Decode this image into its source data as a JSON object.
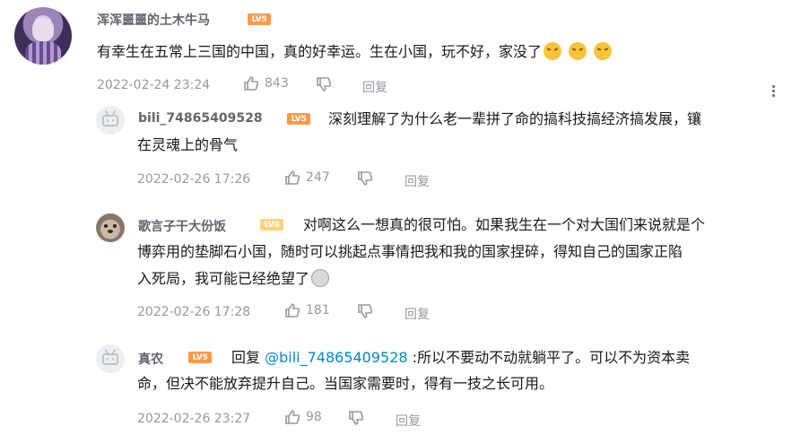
{
  "comment": {
    "username": "浑浑噩噩的土木牛马",
    "level": "LV5",
    "text": "有幸生在五常上三国的中国，真的好幸运。生在小国，玩不好，家没了",
    "date": "2022-02-24 23:24",
    "likes": "843",
    "reply_label": "回复"
  },
  "replies": [
    {
      "username": "bili_74865409528",
      "level": "LV5",
      "text_line1": "深刻理解了为什么老一辈拼了命的搞科技搞经济搞发展，镶",
      "text_line2": "在灵魂上的骨气",
      "date": "2022-02-26 17:26",
      "likes": "247",
      "reply_label": "回复"
    },
    {
      "username": "歌言子干大份饭",
      "level": "LV4",
      "text_line1": "对啊这么一想真的很可怕。如果我生在一个对大国们来说就是个",
      "text_line2": "博弈用的垫脚石小国，随时可以挑起点事情把我和我的国家捏碎，得知自己的国家正陷",
      "text_line3": "入死局，我可能已经绝望了",
      "date": "2022-02-26 17:28",
      "likes": "181",
      "reply_label": "回复"
    },
    {
      "username": "真农",
      "level": "LV5",
      "prefix": "回复",
      "mention": "@bili_74865409528",
      "text_line1": ":所以不要动不动就躺平了。可以不为资本卖",
      "text_line2": "命，但决不能放弃提升自己。当国家需要时，得有一技之长可用。",
      "date": "2022-02-26 23:27",
      "likes": "98",
      "reply_label": "回复"
    }
  ],
  "colors": {
    "level5": "#ff9a4a",
    "level4": "#ffd37a",
    "mention": "#008ac5",
    "meta": "#9499a0"
  }
}
